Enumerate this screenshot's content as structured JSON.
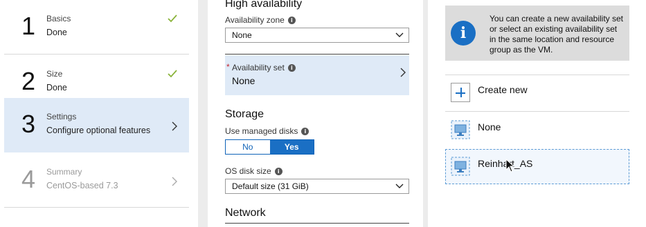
{
  "steps": [
    {
      "number": "1",
      "title": "Basics",
      "subtitle": "Done",
      "state": "done"
    },
    {
      "number": "2",
      "title": "Size",
      "subtitle": "Done",
      "state": "done"
    },
    {
      "number": "3",
      "title": "Settings",
      "subtitle": "Configure optional features",
      "state": "active"
    },
    {
      "number": "4",
      "title": "Summary",
      "subtitle": "CentOS-based 7.3",
      "state": "disabled"
    }
  ],
  "settings": {
    "high_availability": {
      "heading": "High availability",
      "zone_label": "Availability zone",
      "zone_value": "None",
      "set_label": "Availability set",
      "set_required_mark": "*",
      "set_value": "None"
    },
    "storage": {
      "heading": "Storage",
      "managed_disks_label": "Use managed disks",
      "toggle_no": "No",
      "toggle_yes": "Yes",
      "toggle_selected": "Yes",
      "os_disk_label": "OS disk size",
      "os_disk_value": "Default size (31 GiB)"
    },
    "network": {
      "heading": "Network"
    }
  },
  "availability_set": {
    "info": "You can create a new availability set or select an existing availability set in the same location and resource group as the VM.",
    "create_new": "Create new",
    "options": [
      "None",
      "Reinhart_AS"
    ]
  },
  "colors": {
    "accent": "#1a6fc4",
    "check": "#8ab33a",
    "selected_bg": "#dfeaf7",
    "required": "#c4262e"
  }
}
